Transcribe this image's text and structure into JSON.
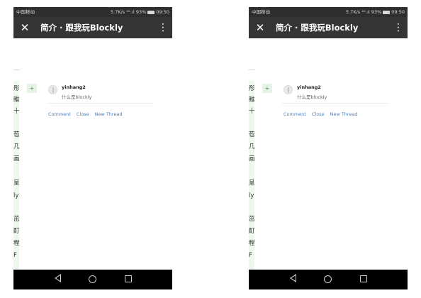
{
  "status_bar": {
    "carrier": "中国移动",
    "net_speed": "5.7K/s",
    "signal": "⁴ᴳ.ıl",
    "battery_percent": "93%",
    "time": "09:50"
  },
  "title_bar": {
    "close_icon": "✕",
    "title": "简介 · 跟我玩Blockly",
    "more_icon": "⋮"
  },
  "sidebar_strip": {
    "chars": [
      "彤",
      "睢",
      "十",
      "苞",
      "几",
      "画",
      "呈",
      "ly",
      "茁",
      "酊",
      "程",
      "F"
    ]
  },
  "comment": {
    "add_label": "+",
    "username": "yinhang2",
    "text": "什么是blockly"
  },
  "actions": {
    "comment": "Comment",
    "close": "Close",
    "new_thread": "New Thread"
  },
  "colors": {
    "title_bar": "#353535",
    "link": "#4a7fc1",
    "strip": "#eef8ee"
  }
}
